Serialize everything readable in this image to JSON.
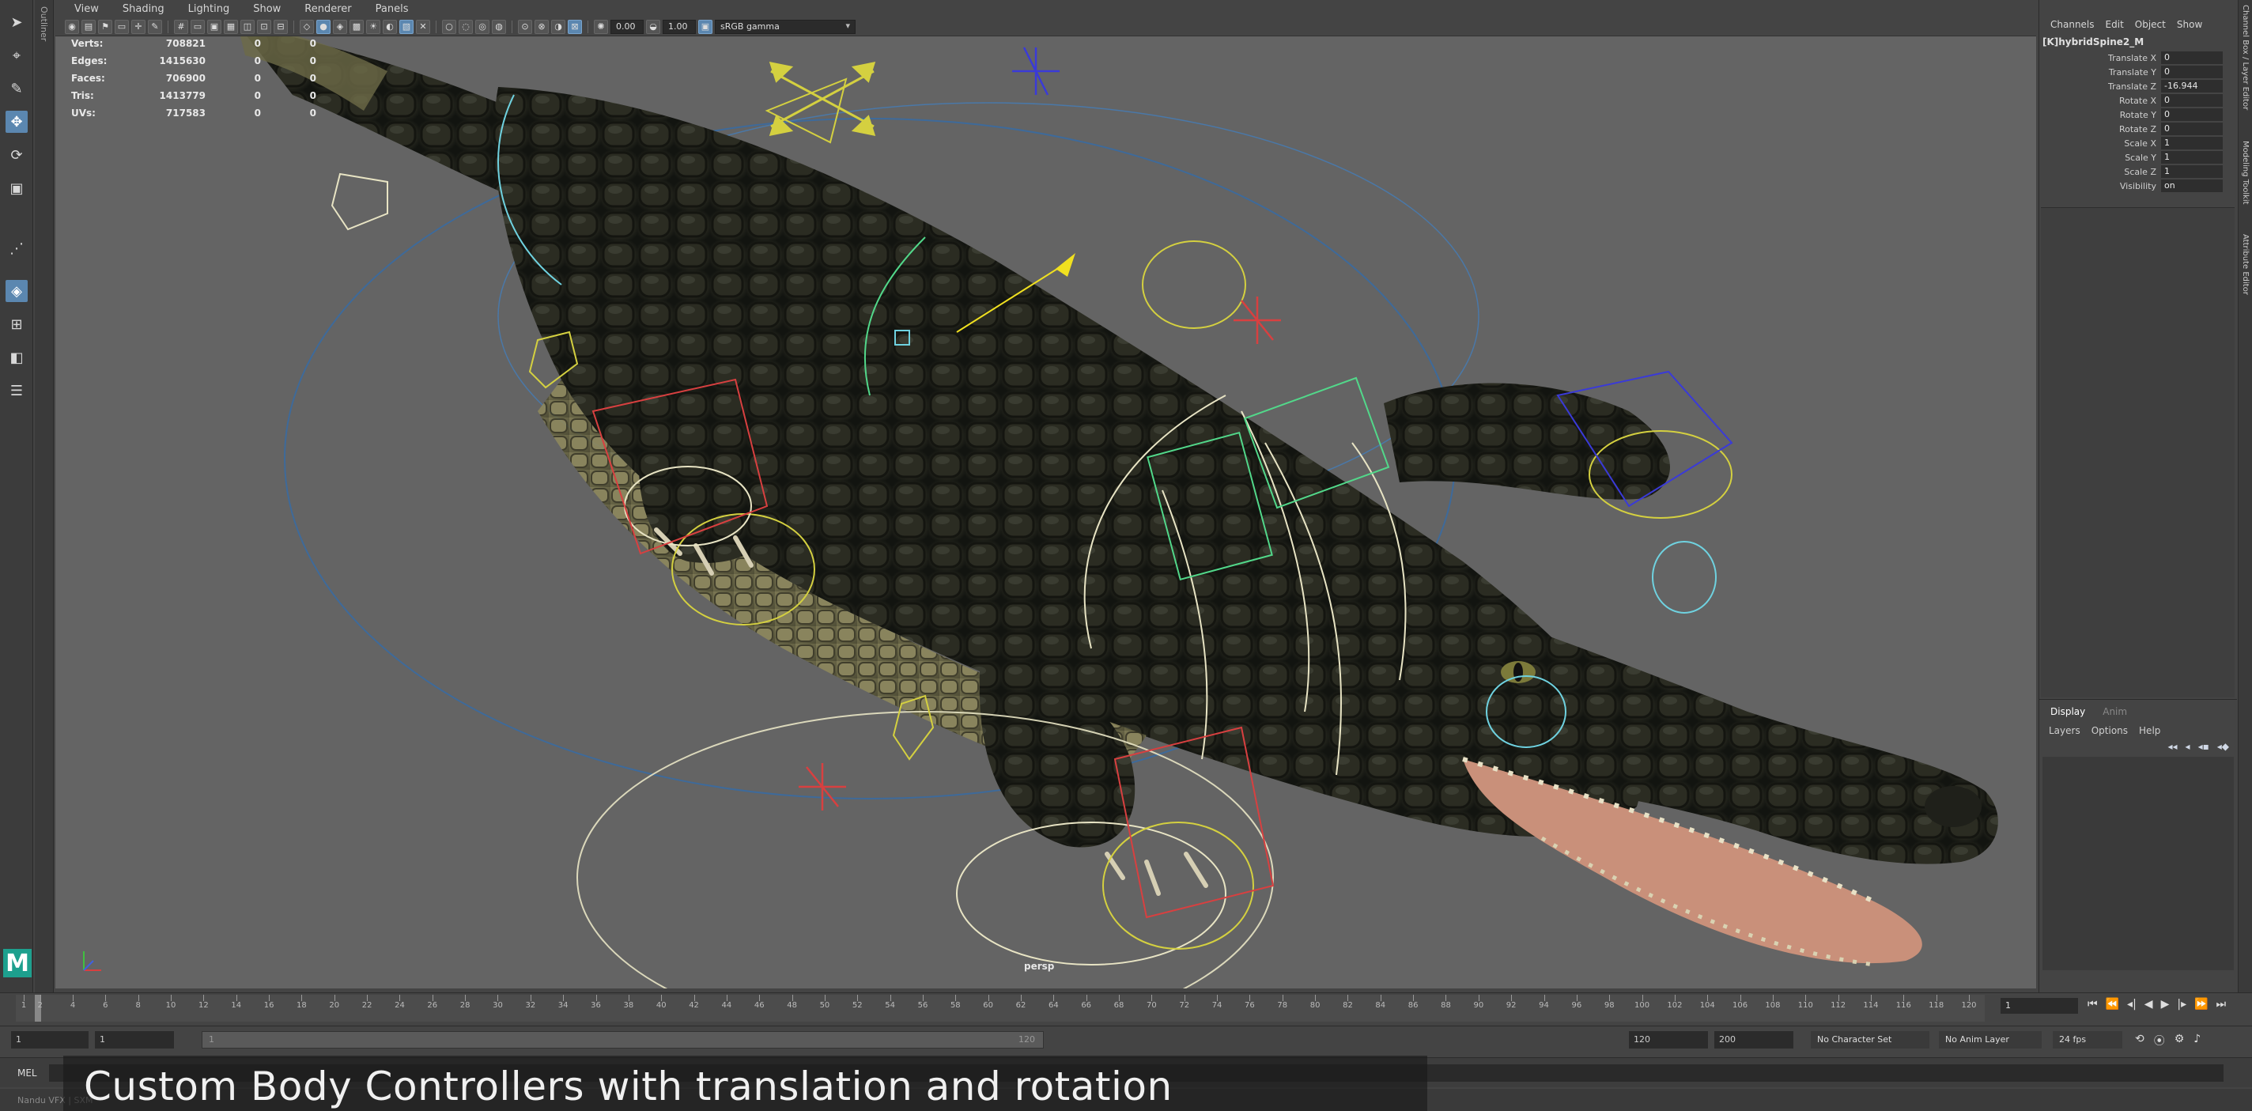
{
  "viewport": {
    "menu": [
      "View",
      "Shading",
      "Lighting",
      "Show",
      "Renderer",
      "Panels"
    ],
    "exposure": "0.00",
    "gamma": "1.00",
    "color_space": "sRGB gamma",
    "camera": "persp",
    "hud": [
      {
        "label": "Verts:",
        "v1": "708821",
        "v2": "0",
        "v3": "0"
      },
      {
        "label": "Edges:",
        "v1": "1415630",
        "v2": "0",
        "v3": "0"
      },
      {
        "label": "Faces:",
        "v1": "706900",
        "v2": "0",
        "v3": "0"
      },
      {
        "label": "Tris:",
        "v1": "1413779",
        "v2": "0",
        "v3": "0"
      },
      {
        "label": "UVs:",
        "v1": "717583",
        "v2": "0",
        "v3": "0"
      }
    ]
  },
  "outliner": {
    "label": "Outliner"
  },
  "channel_box": {
    "menu": [
      "Channels",
      "Edit",
      "Object",
      "Show"
    ],
    "node": "[K]hybridSpine2_M",
    "attributes": [
      {
        "name": "Translate X",
        "value": "0"
      },
      {
        "name": "Translate Y",
        "value": "0"
      },
      {
        "name": "Translate Z",
        "value": "-16.944"
      },
      {
        "name": "Rotate X",
        "value": "0"
      },
      {
        "name": "Rotate Y",
        "value": "0"
      },
      {
        "name": "Rotate Z",
        "value": "0"
      },
      {
        "name": "Scale X",
        "value": "1"
      },
      {
        "name": "Scale Y",
        "value": "1"
      },
      {
        "name": "Scale Z",
        "value": "1"
      },
      {
        "name": "Visibility",
        "value": "on"
      }
    ]
  },
  "layer_editor": {
    "tabs": [
      "Display",
      "Anim"
    ],
    "menu": [
      "Layers",
      "Options",
      "Help"
    ]
  },
  "side_tabs": [
    "Channel Box / Layer Editor",
    "Modeling Toolkit",
    "Attribute Editor"
  ],
  "time_slider": {
    "ticks": [
      "1",
      "2",
      "4",
      "6",
      "8",
      "10",
      "12",
      "14",
      "16",
      "18",
      "20",
      "22",
      "24",
      "26",
      "28",
      "30",
      "32",
      "34",
      "36",
      "38",
      "40",
      "42",
      "44",
      "46",
      "48",
      "50",
      "52",
      "54",
      "56",
      "58",
      "60",
      "62",
      "64",
      "66",
      "68",
      "70",
      "72",
      "74",
      "76",
      "78",
      "80",
      "82",
      "84",
      "86",
      "88",
      "90",
      "92",
      "94",
      "96",
      "98",
      "100",
      "102",
      "104",
      "106",
      "108",
      "110",
      "112",
      "114",
      "116",
      "118",
      "120"
    ],
    "current_frame": "1"
  },
  "range_slider": {
    "start": "1",
    "inner_start": "1",
    "bar_start": "1",
    "bar_end": "120",
    "end": "120",
    "anim_end": "200",
    "character_set": "No Character Set",
    "anim_layer": "No Anim Layer",
    "fps": "24 fps"
  },
  "command_line": {
    "label": "MEL"
  },
  "help_line": {
    "text": "Nandu VFX | SXM"
  },
  "caption": "Custom Body Controllers with translation and rotation"
}
